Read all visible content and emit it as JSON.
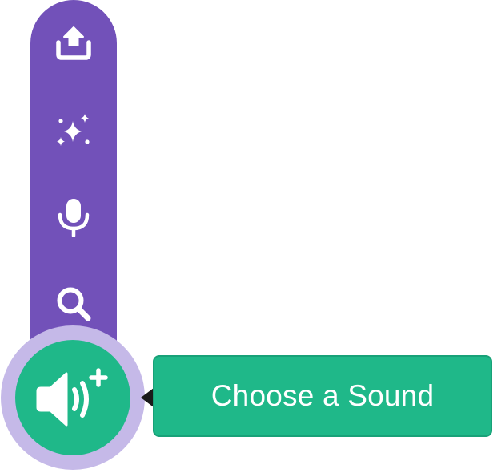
{
  "menu": {
    "items": [
      {
        "icon": "upload-icon",
        "label": ""
      },
      {
        "icon": "sparkles-icon",
        "label": ""
      },
      {
        "icon": "microphone-icon",
        "label": ""
      },
      {
        "icon": "search-icon",
        "label": ""
      }
    ],
    "main_icon": "sound-add-icon"
  },
  "tooltip": {
    "text": "Choose a Sound"
  },
  "colors": {
    "menu_purple": "#7251b9",
    "halo_lavender": "#c5b9e8",
    "accent_green": "#1fb889",
    "icon_white": "#ffffff"
  }
}
